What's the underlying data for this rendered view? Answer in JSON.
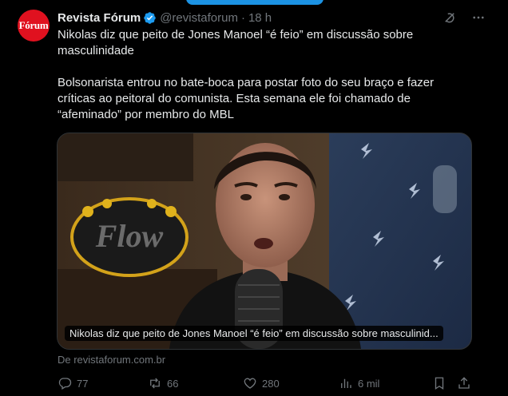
{
  "post": {
    "author_name": "Revista Fórum",
    "avatar_text": "Fórum",
    "handle": "@revistaforum",
    "separator": "·",
    "time": "18 h",
    "headline": "Nikolas diz que peito de Jones Manoel “é feio” em discussão sobre masculinidade",
    "body": "Bolsonarista entrou no bate-boca para postar foto do seu braço e fazer críticas ao peitoral do comunista. Esta semana ele foi chamado de “afeminado” por membro do MBL",
    "card_caption": "Nikolas diz que peito de Jones Manoel “é feio” em discussão sobre masculinid...",
    "source": "De revistaforum.com.br"
  },
  "media": {
    "background_sign_text": "Flow"
  },
  "actions": {
    "replies": "77",
    "reposts": "66",
    "likes": "280",
    "views": "6 mil"
  },
  "colors": {
    "accent": "#1d9bf0",
    "avatar_bg": "#e0111f",
    "muted": "#71767b",
    "text": "#e7e9ea"
  }
}
